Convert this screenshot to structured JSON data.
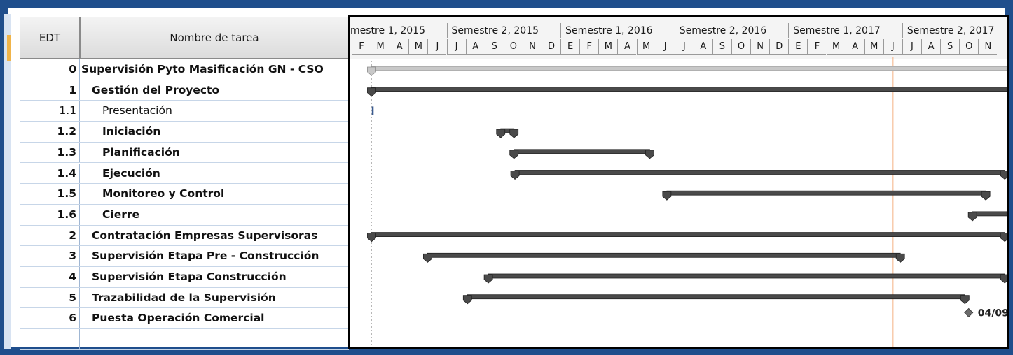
{
  "table": {
    "col_edt": "EDT",
    "col_name": "Nombre de tarea",
    "rows": [
      {
        "edt": "0",
        "name": "Supervisión Pyto Masificación GN - CSO",
        "bold": true,
        "level": 0
      },
      {
        "edt": "1",
        "name": "Gestión del Proyecto",
        "bold": true,
        "level": 1
      },
      {
        "edt": "1.1",
        "name": "Presentación",
        "bold": false,
        "level": 2
      },
      {
        "edt": "1.2",
        "name": "Iniciación",
        "bold": true,
        "level": 2
      },
      {
        "edt": "1.3",
        "name": "Planificación",
        "bold": true,
        "level": 2
      },
      {
        "edt": "1.4",
        "name": "Ejecución",
        "bold": true,
        "level": 2
      },
      {
        "edt": "1.5",
        "name": "Monitoreo y Control",
        "bold": true,
        "level": 2
      },
      {
        "edt": "1.6",
        "name": "Cierre",
        "bold": true,
        "level": 2
      },
      {
        "edt": "2",
        "name": "Contratación Empresas Supervisoras",
        "bold": true,
        "level": 1
      },
      {
        "edt": "3",
        "name": "Supervisión Etapa Pre - Construcción",
        "bold": true,
        "level": 1
      },
      {
        "edt": "4",
        "name": "Supervisión Etapa Construcción",
        "bold": true,
        "level": 1
      },
      {
        "edt": "5",
        "name": "Trazabilidad de la Supervisión",
        "bold": true,
        "level": 1
      },
      {
        "edt": "6",
        "name": "Puesta Operación Comercial",
        "bold": true,
        "level": 1
      }
    ]
  },
  "timescale": {
    "semesters": [
      "mestre 1, 2015",
      "Semestre 2, 2015",
      "Semestre 1, 2016",
      "Semestre 2, 2016",
      "Semestre 1, 2017",
      "Semestre 2, 2017"
    ],
    "months": [
      "F",
      "M",
      "A",
      "M",
      "J",
      "J",
      "A",
      "S",
      "O",
      "N",
      "D",
      "E",
      "F",
      "M",
      "A",
      "M",
      "J",
      "J",
      "A",
      "S",
      "O",
      "N",
      "D",
      "E",
      "F",
      "M",
      "A",
      "M",
      "J",
      "J",
      "A",
      "S",
      "O",
      "N"
    ]
  },
  "gantt": {
    "first_month": 1,
    "status_month": 28.5,
    "bars": [
      {
        "type": "summary-gray",
        "start": 1.05,
        "end": 34.8
      },
      {
        "type": "summary",
        "start": 1.05,
        "end": 34.8
      },
      {
        "type": "tick",
        "start": 1.1,
        "end": 1.1
      },
      {
        "type": "summary",
        "start": 7.85,
        "end": 8.55
      },
      {
        "type": "summary",
        "start": 8.55,
        "end": 15.7
      },
      {
        "type": "summary",
        "start": 8.6,
        "end": 34.4
      },
      {
        "type": "summary",
        "start": 16.6,
        "end": 33.4
      },
      {
        "type": "summary",
        "start": 32.7,
        "end": 34.8
      },
      {
        "type": "summary",
        "start": 1.05,
        "end": 34.4
      },
      {
        "type": "summary",
        "start": 4.0,
        "end": 28.9
      },
      {
        "type": "summary",
        "start": 7.2,
        "end": 34.4
      },
      {
        "type": "summary",
        "start": 6.1,
        "end": 32.3
      },
      {
        "type": "milestone",
        "start": 32.5,
        "end": 32.5
      }
    ],
    "milestone_label": "04/09"
  },
  "colors": {
    "frame": "#1f4e8c",
    "bar": "#4a4a4a",
    "summary_gray": "#c8c8c8",
    "status_line": "#f4b183"
  }
}
